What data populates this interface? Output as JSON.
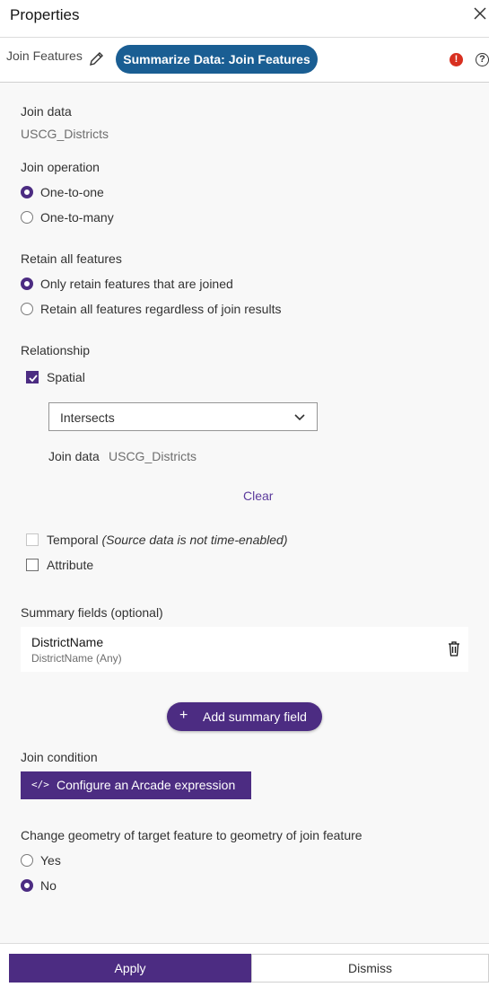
{
  "header": {
    "title": "Properties"
  },
  "toolbar": {
    "tool_name": "Join Features",
    "pill_label": "Summarize Data: Join Features",
    "error_glyph": "!",
    "help_glyph": "?"
  },
  "join_data": {
    "label": "Join data",
    "value": "USCG_Districts"
  },
  "join_operation": {
    "label": "Join operation",
    "options": [
      {
        "label": "One-to-one",
        "checked": true
      },
      {
        "label": "One-to-many",
        "checked": false
      }
    ]
  },
  "retain": {
    "label": "Retain all features",
    "options": [
      {
        "label": "Only retain features that are joined",
        "checked": true
      },
      {
        "label": "Retain all features regardless of join results",
        "checked": false
      }
    ]
  },
  "relationship": {
    "label": "Relationship",
    "spatial_label": "Spatial",
    "spatial_checked": true,
    "spatial_select": "Intersects",
    "join_data_label": "Join data",
    "join_data_value": "USCG_Districts",
    "clear_label": "Clear",
    "temporal_label": "Temporal",
    "temporal_note": "(Source data is not time-enabled)",
    "attribute_label": "Attribute"
  },
  "summary": {
    "label": "Summary fields (optional)",
    "fields": [
      {
        "name": "DistrictName",
        "detail": "DistrictName (Any)"
      }
    ],
    "add_label": "Add summary field",
    "add_glyph": "+"
  },
  "join_condition": {
    "label": "Join condition",
    "button_label": "Configure an Arcade expression",
    "button_glyph": "</>"
  },
  "geometry": {
    "label": "Change geometry of target feature to geometry of join feature",
    "options": [
      {
        "label": "Yes",
        "checked": false
      },
      {
        "label": "No",
        "checked": true
      }
    ]
  },
  "footer": {
    "apply_label": "Apply",
    "dismiss_label": "Dismiss"
  },
  "colors": {
    "accent": "#4c2c82",
    "pill": "#1a5e93",
    "error": "#d83020"
  }
}
